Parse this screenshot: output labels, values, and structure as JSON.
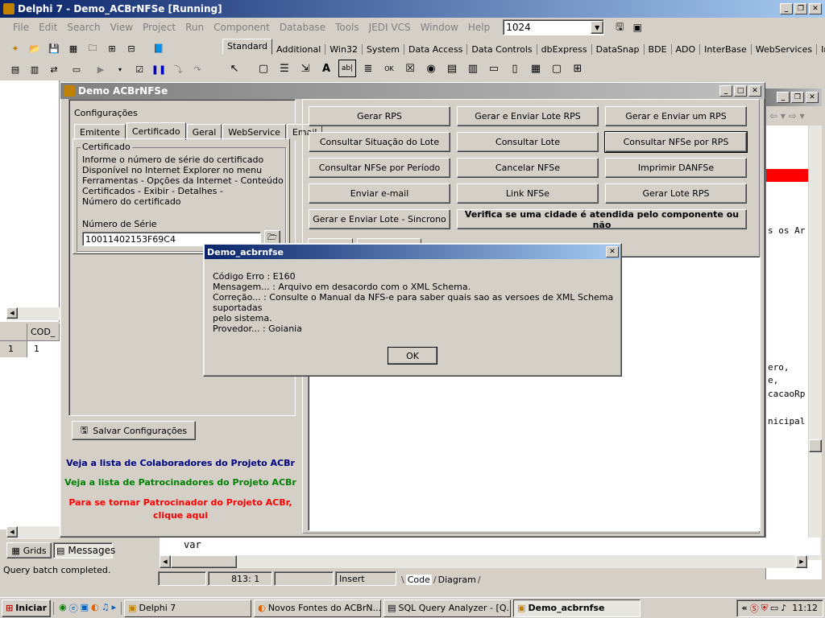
{
  "main_window": {
    "title": "Delphi 7 - Demo_ACBrNFSe [Running]",
    "menu": [
      "File",
      "Edit",
      "Search",
      "View",
      "Project",
      "Run",
      "Component",
      "Database",
      "Tools",
      "JEDI VCS",
      "Window",
      "Help"
    ],
    "combo_value": "1024",
    "palette_tabs": [
      "Standard",
      "Additional",
      "Win32",
      "System",
      "Data Access",
      "Data Controls",
      "dbExpress",
      "DataSnap",
      "BDE",
      "ADO",
      "InterBase",
      "WebServices",
      "Intern"
    ]
  },
  "demo_window": {
    "title": "Demo ACBrNFSe",
    "config_group": "Configurações",
    "tabs": [
      "Emitente",
      "Certificado",
      "Geral",
      "WebService",
      "Email"
    ],
    "cert_group": "Certificado",
    "cert_info": [
      "Informe o número de série do certificado",
      "Disponível no Internet Explorer no menu",
      "Ferramentas - Opções da Internet - Conteúdo",
      "Certificados - Exibir - Detalhes -",
      "Número do certificado"
    ],
    "serial_label": "Número de Série",
    "serial_value": "10011402153F69C4",
    "save_button": "Salvar Configurações",
    "link_collab": "Veja a lista de Colaboradores do Projeto ACBr",
    "link_sponsors": "Veja a lista de Patrocinadores do Projeto ACBr",
    "link_become_1": "Para se tornar Patrocinador do Projeto ACBr,",
    "link_become_2": "clique aqui",
    "buttons": [
      [
        "Gerar RPS",
        "Gerar e Enviar Lote RPS",
        "Gerar e Enviar um RPS"
      ],
      [
        "Consultar Situação do Lote",
        "Consultar Lote",
        "Consultar NFSe por RPS"
      ],
      [
        "Consultar NFSe por Período",
        "Cancelar NFSe",
        "Imprimir DANFSe"
      ],
      [
        "Enviar e-mail",
        "Link NFSe",
        "Gerar Lote RPS"
      ]
    ],
    "btn_sincrono": "Gerar e Enviar Lote - Sincrono",
    "btn_cidade": "Verifica se uma cidade é atendida pelo componente ou não"
  },
  "dialog": {
    "title": "Demo_acbrnfse",
    "lines": [
      "Código Erro : E160",
      "Mensagem... : Arquivo em desacordo com o XML Schema.",
      "Correção... : Consulte o Manual da NFS-e para saber quais sao as versoes de XML Schema suportadas",
      "pelo sistema.",
      "Provedor... : Goiania"
    ],
    "ok": "OK"
  },
  "left_panel": {
    "grid_header": "COD_",
    "row_num": "1",
    "row_val": "1",
    "tab_grids": "Grids",
    "tab_messages": "Messages",
    "status": "Query batch completed."
  },
  "editor": {
    "code_var": "var",
    "right_code": [
      "s os Ar",
      "ero,",
      "e,",
      "cacaoRp",
      "nicipal"
    ],
    "status_pos": "813:  1",
    "status_mode": "Insert",
    "tab_code": "Code",
    "tab_diagram": "Diagram"
  },
  "taskbar": {
    "start": "Iniciar",
    "tasks": [
      "Delphi 7",
      "Novos Fontes do ACBrN...",
      "SQL Query Analyzer - [Q...",
      "Demo_acbrnfse"
    ],
    "clock": "11:12"
  },
  "colors": {
    "title_active": "#0a246a",
    "link_blue": "#000080",
    "link_green": "#008000",
    "link_red": "#ff0000",
    "highlight_red": "#ff0000"
  }
}
